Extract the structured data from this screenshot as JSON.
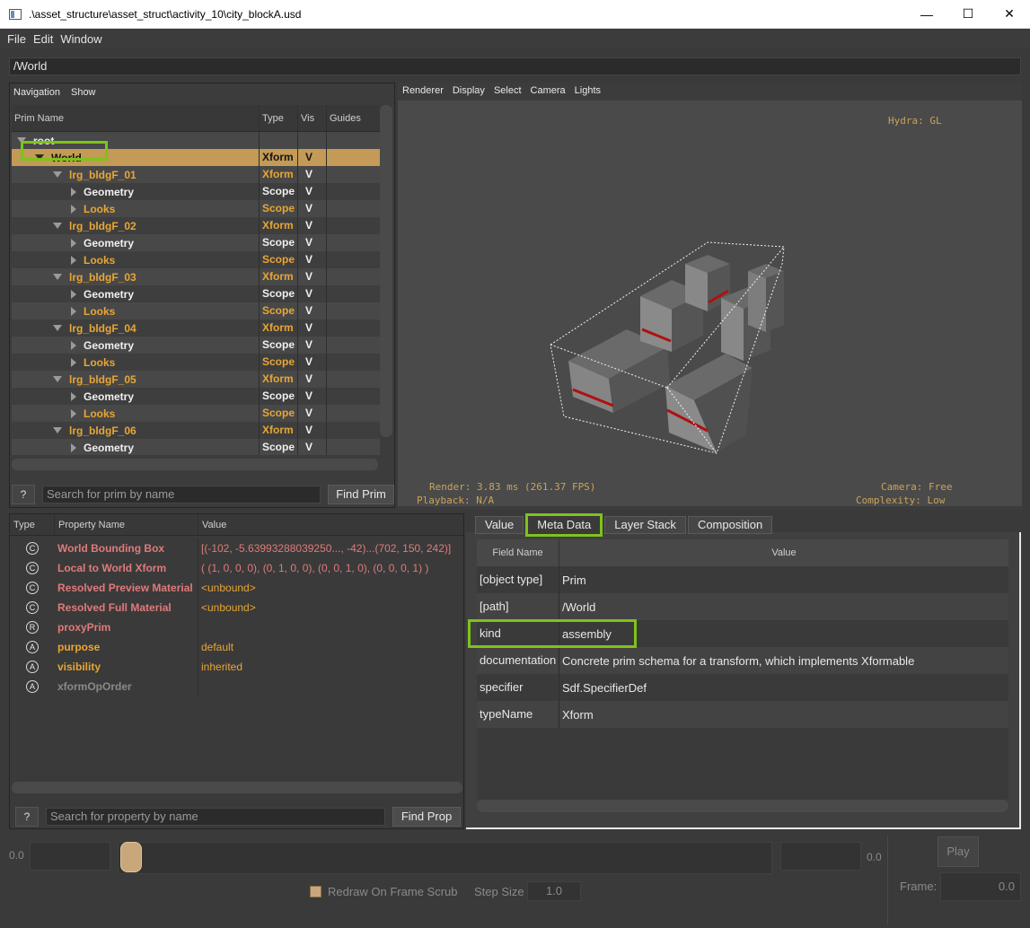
{
  "window": {
    "title": ".\\asset_structure\\asset_struct\\activity_10\\city_blockA.usd",
    "minimize": "—",
    "maximize": "☐",
    "close": "✕"
  },
  "menu": [
    "File",
    "Edit",
    "Window"
  ],
  "path": "/World",
  "tree": {
    "toolbar": [
      "Navigation",
      "Show"
    ],
    "columns": [
      "Prim Name",
      "Type",
      "Vis",
      "Guides"
    ],
    "rows": [
      {
        "name": "root",
        "type": "",
        "vis": ""
      },
      {
        "name": "World",
        "type": "Xform",
        "vis": "V"
      },
      {
        "name": "lrg_bldgF_01",
        "type": "Xform",
        "vis": "V"
      },
      {
        "name": "Geometry",
        "type": "Scope",
        "vis": "V"
      },
      {
        "name": "Looks",
        "type": "Scope",
        "vis": "V"
      },
      {
        "name": "lrg_bldgF_02",
        "type": "Xform",
        "vis": "V"
      },
      {
        "name": "Geometry",
        "type": "Scope",
        "vis": "V"
      },
      {
        "name": "Looks",
        "type": "Scope",
        "vis": "V"
      },
      {
        "name": "lrg_bldgF_03",
        "type": "Xform",
        "vis": "V"
      },
      {
        "name": "Geometry",
        "type": "Scope",
        "vis": "V"
      },
      {
        "name": "Looks",
        "type": "Scope",
        "vis": "V"
      },
      {
        "name": "lrg_bldgF_04",
        "type": "Xform",
        "vis": "V"
      },
      {
        "name": "Geometry",
        "type": "Scope",
        "vis": "V"
      },
      {
        "name": "Looks",
        "type": "Scope",
        "vis": "V"
      },
      {
        "name": "lrg_bldgF_05",
        "type": "Xform",
        "vis": "V"
      },
      {
        "name": "Geometry",
        "type": "Scope",
        "vis": "V"
      },
      {
        "name": "Looks",
        "type": "Scope",
        "vis": "V"
      },
      {
        "name": "lrg_bldgF_06",
        "type": "Xform",
        "vis": "V"
      },
      {
        "name": "Geometry",
        "type": "Scope",
        "vis": "V"
      }
    ],
    "help": "?",
    "search_placeholder": "Search for prim by name",
    "find": "Find Prim"
  },
  "viewport": {
    "toolbar": [
      "Renderer",
      "Display",
      "Select",
      "Camera",
      "Lights"
    ],
    "hydra": "Hydra: GL",
    "render": "Render: 3.83 ms (261.37 FPS)",
    "playback": "Playback: N/A",
    "camera": "Camera: Free",
    "complexity": "Complexity: Low"
  },
  "properties": {
    "columns": [
      "Type",
      "Property Name",
      "Value"
    ],
    "rows": [
      {
        "icon": "C",
        "name": "World Bounding Box",
        "value": "[(-102, -5.63993288039250..., -42)...(702, 150, 242)]",
        "color": "pink"
      },
      {
        "icon": "C",
        "name": "Local to World Xform",
        "value": "( (1, 0, 0, 0), (0, 1, 0, 0), (0, 0, 1, 0), (0, 0, 0, 1) )",
        "color": "pink"
      },
      {
        "icon": "C",
        "name": "Resolved Preview Material",
        "value": "<unbound>",
        "color": "pink"
      },
      {
        "icon": "C",
        "name": "Resolved Full Material",
        "value": "<unbound>",
        "color": "pink"
      },
      {
        "icon": "R",
        "name": "proxyPrim",
        "value": "",
        "color": "pink"
      },
      {
        "icon": "A",
        "name": "purpose",
        "value": "default",
        "color": "gold"
      },
      {
        "icon": "A",
        "name": "visibility",
        "value": "inherited",
        "color": "gold"
      },
      {
        "icon": "A",
        "name": "xformOpOrder",
        "value": "",
        "color": "grey"
      }
    ],
    "help": "?",
    "search_placeholder": "Search for property by name",
    "find": "Find Prop"
  },
  "metadata": {
    "tabs": [
      "Value",
      "Meta Data",
      "Layer Stack",
      "Composition"
    ],
    "columns": [
      "Field Name",
      "Value"
    ],
    "rows": [
      {
        "field": "[object type]",
        "value": "Prim"
      },
      {
        "field": "[path]",
        "value": "/World"
      },
      {
        "field": "kind",
        "value": "assembly"
      },
      {
        "field": "documentation",
        "value": "Concrete prim schema for a transform, which implements Xformable"
      },
      {
        "field": "specifier",
        "value": "Sdf.SpecifierDef"
      },
      {
        "field": "typeName",
        "value": "Xform"
      }
    ]
  },
  "timeline": {
    "start": "0.0",
    "end": "0.0",
    "play": "Play",
    "redraw": "Redraw On Frame Scrub",
    "step_label": "Step Size",
    "step_value": "1.0",
    "frame_label": "Frame:",
    "frame_value": "0.0"
  },
  "colors": {
    "accent": "#c39a56",
    "highlight": "#7ec31b",
    "prim_orange": "#e8a634",
    "prop_pink": "#e07a7a"
  }
}
